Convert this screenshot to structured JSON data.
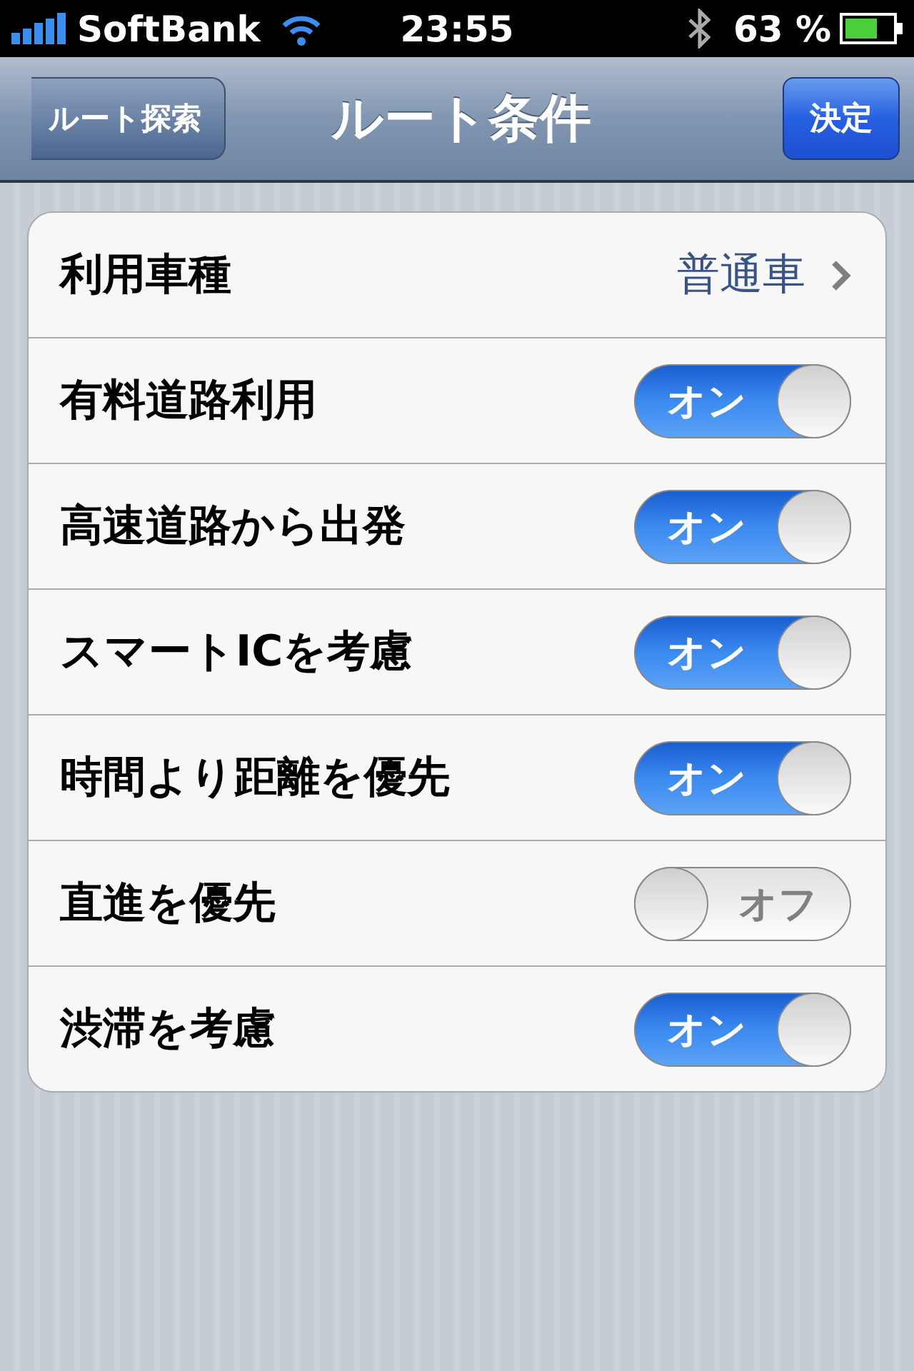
{
  "status_bar": {
    "carrier": "SoftBank",
    "time": "23:55",
    "battery": "63 %"
  },
  "nav_bar": {
    "back_button": "ルート探索",
    "title": "ルート条件",
    "done_button": "決定"
  },
  "rows": [
    {
      "kind": "disclosure",
      "label": "利用車種",
      "value": "普通車"
    },
    {
      "kind": "switch",
      "label": "有料道路利用",
      "on": true,
      "switch_text": "オン"
    },
    {
      "kind": "switch",
      "label": "高速道路から出発",
      "on": true,
      "switch_text": "オン"
    },
    {
      "kind": "switch",
      "label": "スマートICを考慮",
      "on": true,
      "switch_text": "オン"
    },
    {
      "kind": "switch",
      "label": "時間より距離を優先",
      "on": true,
      "switch_text": "オン"
    },
    {
      "kind": "switch",
      "label": "直進を優先",
      "on": false,
      "switch_text": "オフ"
    },
    {
      "kind": "switch",
      "label": "渋滞を考慮",
      "on": true,
      "switch_text": "オン"
    }
  ]
}
